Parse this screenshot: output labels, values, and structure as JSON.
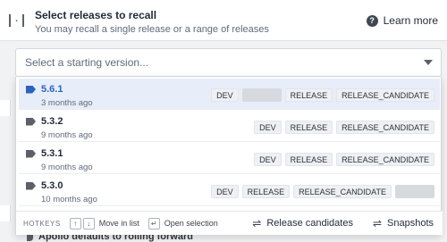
{
  "header": {
    "title": "Select releases to recall",
    "subtitle": "You may recall a single release or a range of releases",
    "learn_more": "Learn more"
  },
  "select": {
    "placeholder": "Select a starting version..."
  },
  "options": [
    {
      "version": "5.6.1",
      "time": "3 months ago",
      "badges": [
        "DEV",
        "",
        "RELEASE",
        "RELEASE_CANDIDATE"
      ]
    },
    {
      "version": "5.3.2",
      "time": "9 months ago",
      "badges": [
        "DEV",
        "RELEASE",
        "RELEASE_CANDIDATE"
      ]
    },
    {
      "version": "5.3.1",
      "time": "9 months ago",
      "badges": [
        "DEV",
        "RELEASE",
        "RELEASE_CANDIDATE"
      ]
    },
    {
      "version": "5.3.0",
      "time": "10 months ago",
      "badges": [
        "DEV",
        "RELEASE",
        "RELEASE_CANDIDATE",
        ""
      ]
    }
  ],
  "footer": {
    "hotkeys": "HOTKEYS",
    "move_in_list": "Move in list",
    "open_selection": "Open selection",
    "release_candidates": "Release candidates",
    "snapshots": "Snapshots"
  },
  "background": {
    "footer_text": "Apollo defaults to rolling forward"
  },
  "colors": {
    "accent": "#2d64b9",
    "active_row": "#e7eef9"
  }
}
